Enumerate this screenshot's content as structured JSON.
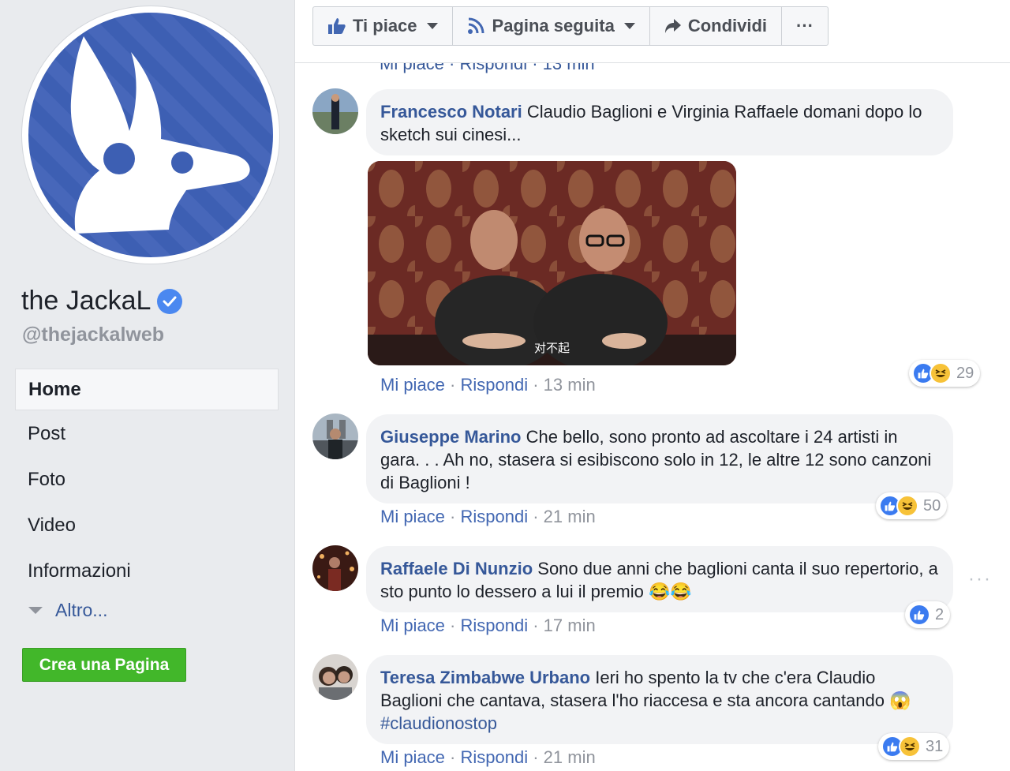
{
  "page": {
    "name": "the JackaL",
    "handle": "@thejackalweb",
    "nav": [
      "Home",
      "Post",
      "Foto",
      "Video",
      "Informazioni"
    ],
    "more_label": "Altro...",
    "create_page_label": "Crea una Pagina"
  },
  "actions": {
    "like_label": "Ti piace",
    "follow_label": "Pagina seguita",
    "share_label": "Condividi",
    "more_label": "···"
  },
  "cut_line": "Mi piace · Rispondi · 13 min",
  "comments": [
    {
      "author": "Francesco Notari",
      "text": "Claudio Baglioni e Virginia Raffaele domani dopo lo sketch sui cinesi...",
      "like_label": "Mi piace",
      "reply_label": "Rispondi",
      "time": "13 min",
      "reactions": "29",
      "video_caption": "对不起"
    },
    {
      "author": "Giuseppe Marino",
      "text": "Che bello, sono pronto ad ascoltare i 24 artisti in gara. . . Ah no, stasera si esibiscono solo in 12, le altre 12 sono canzoni di Baglioni !",
      "like_label": "Mi piace",
      "reply_label": "Rispondi",
      "time": "21 min",
      "reactions": "50"
    },
    {
      "author": "Raffaele Di Nunzio",
      "text": "Sono due anni che baglioni canta il suo repertorio, a sto punto lo dessero a lui il premio 😂😂",
      "like_label": "Mi piace",
      "reply_label": "Rispondi",
      "time": "17 min",
      "reactions": "2"
    },
    {
      "author": "Teresa Zimbabwe Urbano",
      "text": "Ieri ho spento la tv che c'era Claudio Baglioni che cantava, stasera l'ho riaccesa e sta ancora cantando 😱 ",
      "hashtag": "#claudionostop",
      "like_label": "Mi piace",
      "reply_label": "Rispondi",
      "time": "21 min",
      "reactions": "31"
    }
  ],
  "colors": {
    "link": "#365899",
    "page_bg": "#e9ebee",
    "bubble_bg": "#f2f3f5",
    "create_button": "#42b72a",
    "logo_blue": "#3b5db0"
  }
}
